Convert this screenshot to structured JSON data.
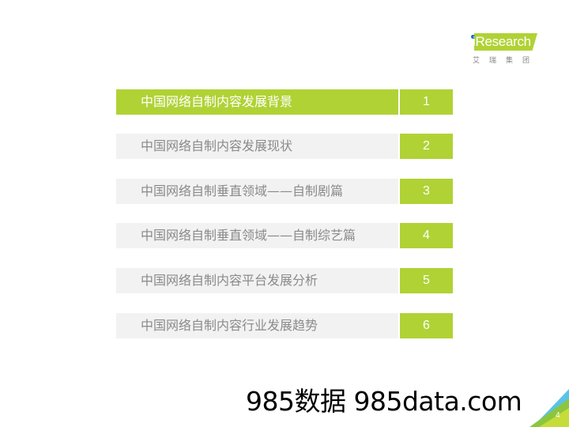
{
  "logo": {
    "brand": "iResearch",
    "subtitle": "艾瑞集团"
  },
  "colors": {
    "accent": "#b0d235",
    "row_bg": "#f2f2f2",
    "text_gray": "#8a8a8a",
    "logo_dot": "#1b6fb8",
    "corner_blue": "#5bc2e7"
  },
  "toc": [
    {
      "label": "中国网络自制内容发展背景",
      "number": "1",
      "active": true
    },
    {
      "label": "中国网络自制内容发展现状",
      "number": "2",
      "active": false
    },
    {
      "label": "中国网络自制垂直领域——自制剧篇",
      "number": "3",
      "active": false
    },
    {
      "label": "中国网络自制垂直领域——自制综艺篇",
      "number": "4",
      "active": false
    },
    {
      "label": "中国网络自制内容平台发展分析",
      "number": "5",
      "active": false
    },
    {
      "label": "中国网络自制内容行业发展趋势",
      "number": "6",
      "active": false
    }
  ],
  "watermark": "985数据 985data.com",
  "page_number": "4"
}
